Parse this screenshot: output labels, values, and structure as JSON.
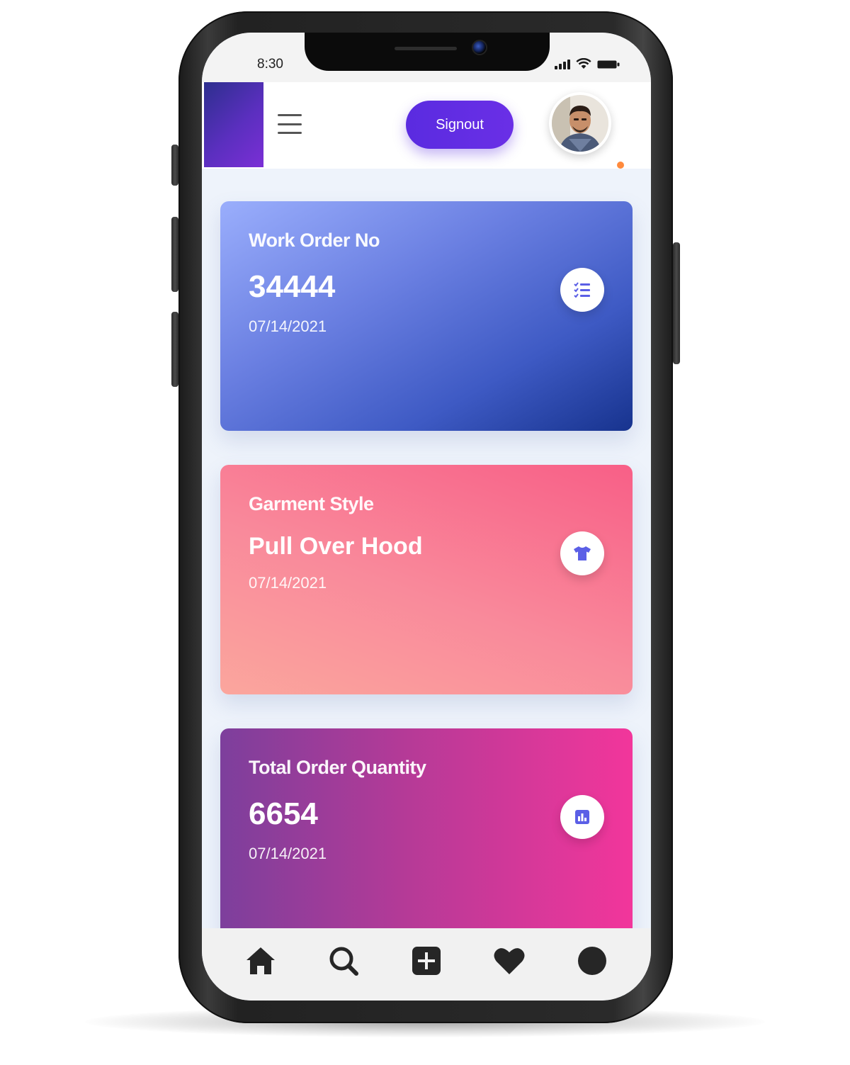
{
  "status_bar": {
    "time": "8:30"
  },
  "app_bar": {
    "signout_label": "Signout",
    "avatar_icon": "avatar-photo"
  },
  "cards": [
    {
      "label": "Work Order No",
      "value": "34444",
      "date": "07/14/2021",
      "icon": "checklist-icon"
    },
    {
      "label": "Garment Style",
      "value": "Pull Over Hood",
      "date": "07/14/2021",
      "icon": "tshirt-icon"
    },
    {
      "label": "Total Order Quantity",
      "value": "6654",
      "date": "07/14/2021",
      "icon": "report-icon"
    }
  ],
  "bottom_nav": [
    {
      "icon": "home-icon"
    },
    {
      "icon": "search-icon"
    },
    {
      "icon": "add-square-icon"
    },
    {
      "icon": "heart-icon"
    },
    {
      "icon": "profile-circle-icon"
    }
  ],
  "colors": {
    "accent": "#6a2fe6",
    "card_blue": "#3e5ac4",
    "card_pink": "#f85f87",
    "card_purple": "#b53a97",
    "online_dot": "#ff8a3d"
  }
}
